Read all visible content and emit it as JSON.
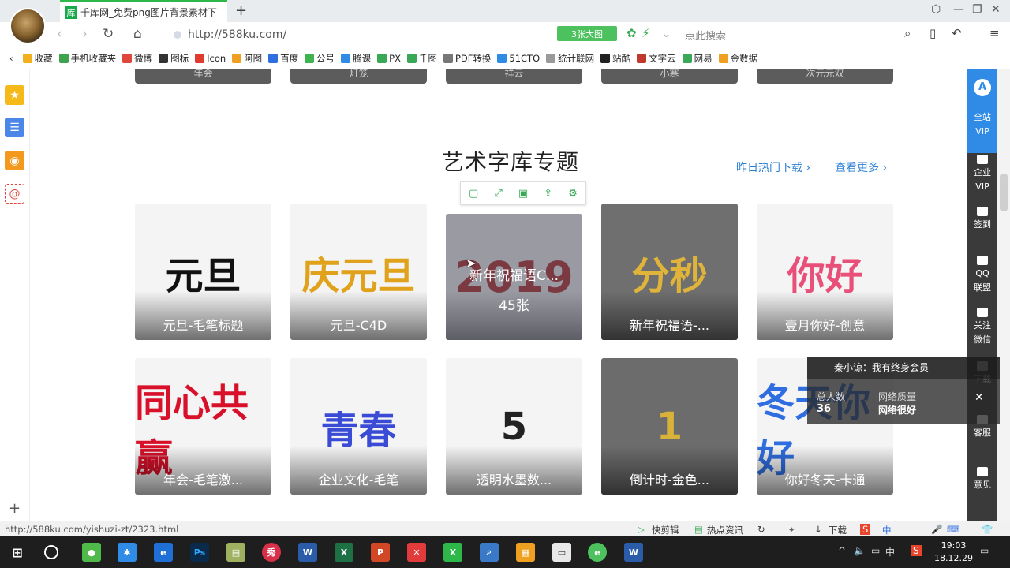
{
  "browser": {
    "tab_icon": "库",
    "tab_title": "千库网_免费png图片背景素材下",
    "url": "http://588ku.com/",
    "bigpic_label": "3张大图",
    "search_placeholder": "点此搜索",
    "new_tab": "+"
  },
  "bookmarks": [
    {
      "label": "收藏",
      "color": "#f2b01e"
    },
    {
      "label": "手机收藏夹",
      "color": "#3fa34d"
    },
    {
      "label": "微博",
      "color": "#e0463b"
    },
    {
      "label": "图标",
      "color": "#333333"
    },
    {
      "label": "Icon",
      "color": "#e03a2f"
    },
    {
      "label": "阿图",
      "color": "#f0a020"
    },
    {
      "label": "百度",
      "color": "#2f6de0"
    },
    {
      "label": "公号",
      "color": "#3fb34f"
    },
    {
      "label": "腾课",
      "color": "#2f8be6"
    },
    {
      "label": "PX",
      "color": "#3aa957"
    },
    {
      "label": "千图",
      "color": "#3aa957"
    },
    {
      "label": "PDF转换",
      "color": "#777777"
    },
    {
      "label": "51CTO",
      "color": "#2f8be6"
    },
    {
      "label": "统计联网",
      "color": "#999999"
    },
    {
      "label": "站酷",
      "color": "#222222"
    },
    {
      "label": "文字云",
      "color": "#c0392b"
    },
    {
      "label": "网易",
      "color": "#3aa957"
    },
    {
      "label": "金数据",
      "color": "#f0a020"
    }
  ],
  "top_row_labels": [
    "年会",
    "灯笼",
    "祥云",
    "小寒",
    "次元元双"
  ],
  "section": {
    "title": "艺术字库专题",
    "link_hot": "昨日热门下载 ›",
    "link_more": "查看更多 ›"
  },
  "hover_card": {
    "title": "新年祝福语C...",
    "count": "45张",
    "art_text": "2019"
  },
  "cards_row1": [
    {
      "label": "元旦-毛笔标题",
      "art": "元旦",
      "art_color": "#111111",
      "bg": "#f4f4f4"
    },
    {
      "label": "元旦-C4D",
      "art": "庆元旦",
      "art_color": "#e0a21b",
      "bg": "#f4f4f4"
    },
    {
      "label": "",
      "art": "",
      "art_color": "#b02020",
      "bg": "#f4f4f4"
    },
    {
      "label": "新年祝福语-...",
      "art": "分秒",
      "art_color": "#e0b43a",
      "bg": "#6f6f6f"
    },
    {
      "label": "壹月你好-创意",
      "art": "你好",
      "art_color": "#e8507a",
      "bg": "#f4f4f4"
    }
  ],
  "cards_row2": [
    {
      "label": "年会-毛笔激...",
      "art": "同心共赢",
      "art_color": "#d8102a",
      "bg": "#f4f4f4"
    },
    {
      "label": "企业文化-毛笔",
      "art": "青春",
      "art_color": "#3a4bd6",
      "bg": "#f4f4f4"
    },
    {
      "label": "透明水墨数...",
      "art": "5",
      "art_color": "#222222",
      "bg": "#f4f4f4"
    },
    {
      "label": "倒计时-金色...",
      "art": "1",
      "art_color": "#d9b23a",
      "bg": "#6c6c6c"
    },
    {
      "label": "你好冬天-卡通",
      "art": "冬天你好",
      "art_color": "#2f6ee0",
      "bg": "#f4f4f4"
    }
  ],
  "right_panel": {
    "vip": "全站\nVIP",
    "items": [
      "企业\nVIP",
      "签到",
      "QQ\n联盟",
      "关注\n微信",
      "下载",
      "客服",
      "意见"
    ]
  },
  "live_popup": {
    "message": "秦小谅：我有终身会员",
    "total_label": "总人数",
    "total_value": "36",
    "net_label": "网络质量",
    "net_value": "网络很好",
    "close": "✕"
  },
  "status": {
    "url": "http://588ku.com/yishuzi-zt/2323.html",
    "items": [
      "快剪辑",
      "热点资讯",
      "下载"
    ]
  },
  "taskbar": {
    "time": "19:03",
    "date": "18.12.29",
    "ime": "中"
  }
}
